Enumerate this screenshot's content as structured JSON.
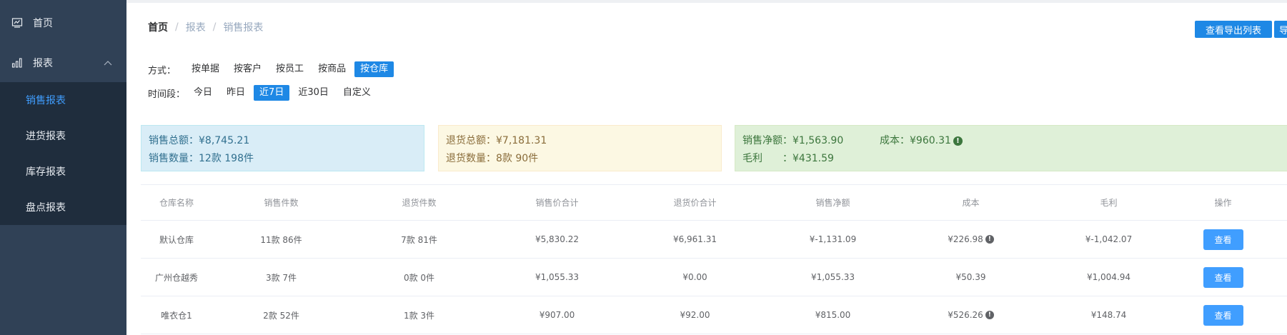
{
  "sidebar": {
    "home": "首页",
    "reports": "报表",
    "sub_items": [
      "销售报表",
      "进货报表",
      "库存报表",
      "盘点报表"
    ]
  },
  "breadcrumb": {
    "home": "首页",
    "sep": "/",
    "reports": "报表",
    "current": "销售报表"
  },
  "toolbar": {
    "export_list": "查看导出列表",
    "export_cut": "导"
  },
  "filters": {
    "mode_label": "方式：",
    "modes": [
      "按单据",
      "按客户",
      "按员工",
      "按商品",
      "按仓库"
    ],
    "mode_active": "按仓库",
    "period_label": "时间段：",
    "periods": [
      "今日",
      "昨日",
      "近7日",
      "近30日",
      "自定义"
    ],
    "period_active": "近7日"
  },
  "summary": {
    "sales_total": "销售总额：¥8,745.21",
    "sales_count": "销售数量：12款 198件",
    "return_total": "退货总额：¥7,181.31",
    "return_count": "退货数量：8款 90件",
    "net_sales": "销售净额：¥1,563.90",
    "cost": "成本：¥960.31",
    "gross_profit": "毛利　　：¥431.59",
    "info_glyph": "!"
  },
  "table": {
    "headers": [
      "仓库名称",
      "销售件数",
      "退货件数",
      "销售价合计",
      "退货价合计",
      "销售净额",
      "成本",
      "毛利",
      "操作"
    ],
    "rows": [
      [
        "默认仓库",
        "11款 86件",
        "7款 81件",
        "¥5,830.22",
        "¥6,961.31",
        "¥-1,131.09",
        "¥226.98",
        "¥-1,042.07",
        "查看"
      ],
      [
        "广州仓越秀",
        "3款 7件",
        "0款 0件",
        "¥1,055.33",
        "¥0.00",
        "¥1,055.33",
        "¥50.39",
        "¥1,004.94",
        "查看"
      ],
      [
        "唯衣仓1",
        "2款 52件",
        "1款 3件",
        "¥907.00",
        "¥92.00",
        "¥815.00",
        "¥526.26",
        "¥148.74",
        "查看"
      ]
    ],
    "cost_info": [
      true,
      false,
      true
    ],
    "info_glyph": "!"
  },
  "colors": {
    "accent": "#1e88e5",
    "sidebar_bg": "#304156",
    "submenu_bg": "#1f2d3d"
  }
}
